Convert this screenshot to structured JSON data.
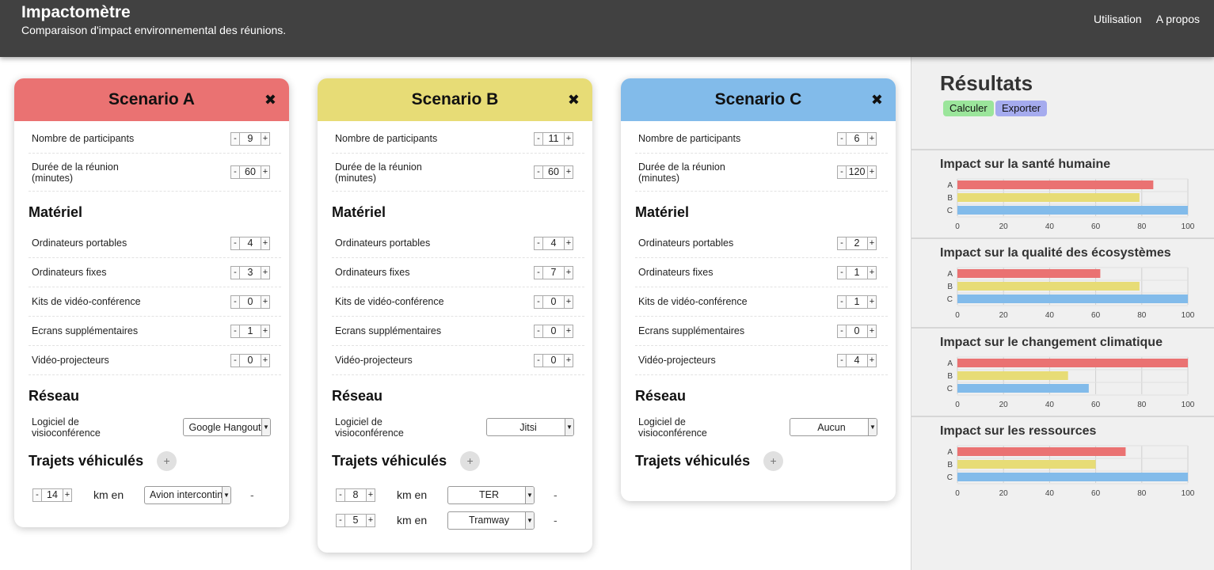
{
  "header": {
    "title": "Impactomètre",
    "subtitle": "Comparaison d'impact environnemental des réunions.",
    "nav": [
      "Utilisation",
      "A propos"
    ]
  },
  "labels": {
    "participants": "Nombre de participants",
    "duration": "Durée de la réunion (minutes)",
    "materiel": "Matériel",
    "laptops": "Ordinateurs portables",
    "desktops": "Ordinateurs fixes",
    "visio_kits": "Kits de vidéo-conférence",
    "screens": "Ecrans supplémentaires",
    "projectors": "Vidéo-projecteurs",
    "reseau": "Réseau",
    "software": "Logiciel de visioconférence",
    "trajets": "Trajets véhiculés",
    "km_en": "km en",
    "minus": "-",
    "plus": "+",
    "add": "+",
    "close": "✖",
    "remove": "-"
  },
  "scenarios": [
    {
      "name": "Scenario A",
      "color": "#ea7272",
      "participants": "9",
      "duration": "60",
      "laptops": "4",
      "desktops": "3",
      "visio_kits": "0",
      "screens": "1",
      "projectors": "0",
      "software": "Google Hangout",
      "trips": [
        {
          "km": "14",
          "mode": "Avion intercontinental"
        }
      ]
    },
    {
      "name": "Scenario B",
      "color": "#e7dc76",
      "participants": "11",
      "duration": "60",
      "laptops": "4",
      "desktops": "7",
      "visio_kits": "0",
      "screens": "0",
      "projectors": "0",
      "software": "Jitsi",
      "trips": [
        {
          "km": "8",
          "mode": "TER"
        },
        {
          "km": "5",
          "mode": "Tramway"
        }
      ]
    },
    {
      "name": "Scenario C",
      "color": "#82bbea",
      "participants": "6",
      "duration": "120",
      "laptops": "2",
      "desktops": "1",
      "visio_kits": "1",
      "screens": "0",
      "projectors": "4",
      "software": "Aucun",
      "trips": []
    }
  ],
  "results": {
    "title": "Résultats",
    "calculate_label": "Calculer",
    "export_label": "Exporter"
  },
  "chart_data": [
    {
      "type": "bar",
      "title": "Impact sur la santé humaine",
      "categories": [
        "A",
        "B",
        "C"
      ],
      "values": [
        85,
        79,
        100
      ],
      "xlim": [
        0,
        100
      ],
      "ticks": [
        0,
        20,
        40,
        60,
        80,
        100
      ],
      "colors": [
        "#ea7272",
        "#e7dc76",
        "#82bbea"
      ],
      "grid": true
    },
    {
      "type": "bar",
      "title": "Impact sur la qualité des écosystèmes",
      "categories": [
        "A",
        "B",
        "C"
      ],
      "values": [
        62,
        79,
        100
      ],
      "xlim": [
        0,
        100
      ],
      "ticks": [
        0,
        20,
        40,
        60,
        80,
        100
      ],
      "colors": [
        "#ea7272",
        "#e7dc76",
        "#82bbea"
      ],
      "grid": true
    },
    {
      "type": "bar",
      "title": "Impact sur le changement climatique",
      "categories": [
        "A",
        "B",
        "C"
      ],
      "values": [
        100,
        48,
        57
      ],
      "xlim": [
        0,
        100
      ],
      "ticks": [
        0,
        20,
        40,
        60,
        80,
        100
      ],
      "colors": [
        "#ea7272",
        "#e7dc76",
        "#82bbea"
      ],
      "grid": true
    },
    {
      "type": "bar",
      "title": "Impact sur les ressources",
      "categories": [
        "A",
        "B",
        "C"
      ],
      "values": [
        73,
        60,
        100
      ],
      "xlim": [
        0,
        100
      ],
      "ticks": [
        0,
        20,
        40,
        60,
        80,
        100
      ],
      "colors": [
        "#ea7272",
        "#e7dc76",
        "#82bbea"
      ],
      "grid": true
    }
  ]
}
